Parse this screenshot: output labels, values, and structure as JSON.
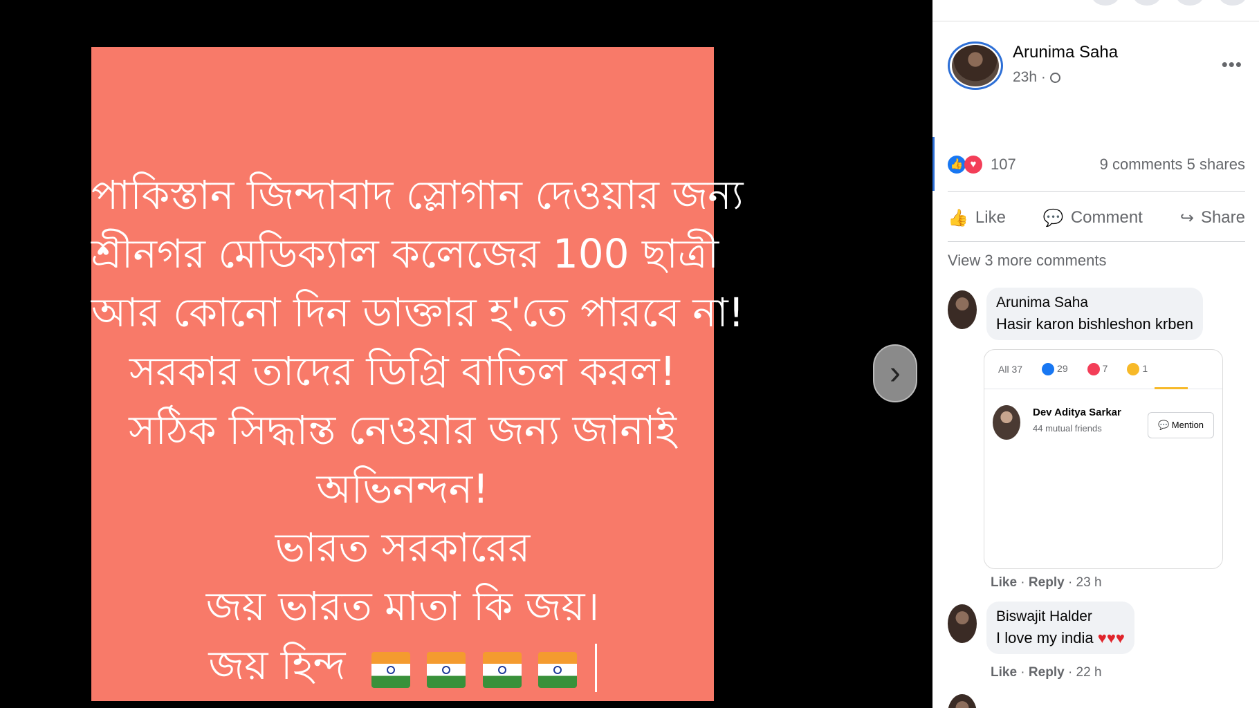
{
  "post_image": {
    "lines": [
      "পাকিস্তান জিন্দাবাদ স্লোগান দেওয়ার জন্য",
      "শ্রীনগর মেডিক্যাল কলেজের 100 ছাত্রী",
      "আর কোনো দিন ডাক্তার হ'তে পারবে না!",
      "সরকার তাদের ডিগ্রি বাতিল করল!",
      "সঠিক সিদ্ধান্ত নেওয়ার জন্য জানাই",
      "অভিনন্দন!",
      "ভারত সরকারের",
      "জয় ভারত মাতা কি জয়।",
      "জয় হিন্দ"
    ],
    "flag_icon": "india-flag-emoji",
    "background_color": "#f87a69"
  },
  "viewer": {
    "next_icon": "›"
  },
  "post": {
    "author_name": "Arunima Saha",
    "time": "23h ·",
    "more_icon": "•••",
    "reaction_count": "107",
    "comments_count": "9 comments",
    "shares_count": "5 shares",
    "actions": {
      "like": "Like",
      "comment": "Comment",
      "share": "Share"
    },
    "view_more": "View 3 more comments"
  },
  "comments": [
    {
      "name": "Arunima Saha",
      "text": "Hasir karon bishleshon krben",
      "like": "Like",
      "reply": "Reply",
      "time": "· 23 h"
    },
    {
      "name": "Biswajit Halder",
      "text": "I love my india",
      "hearts": "♥♥♥",
      "like": "Like",
      "reply": "Reply",
      "time": "· 22 h"
    }
  ],
  "attached_screenshot": {
    "tab_all": "All 37",
    "tab_like": "29",
    "tab_love": "7",
    "tab_haha": "1",
    "person_name": "Dev Aditya Sarkar",
    "person_sub": "44 mutual friends",
    "mention_label": "Mention"
  }
}
